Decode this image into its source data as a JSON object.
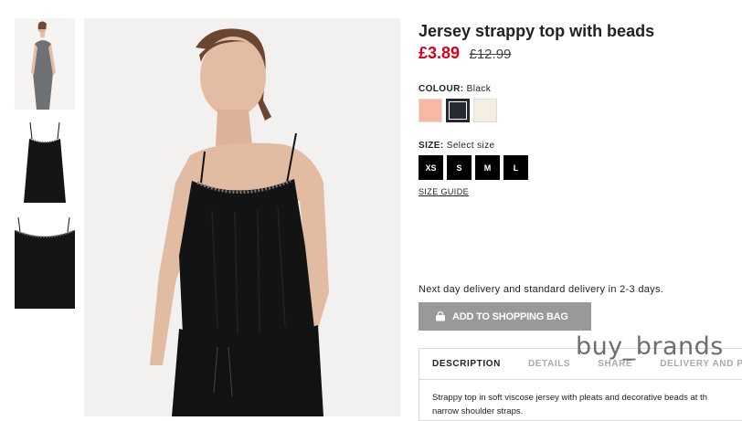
{
  "gallery": {
    "thumbnails": [
      {
        "alt": "model-full-view"
      },
      {
        "alt": "top-front-view"
      },
      {
        "alt": "top-neckline-detail"
      }
    ]
  },
  "product": {
    "title": "Jersey strappy top with beads",
    "price_current": "£3.89",
    "price_original": "£12.99"
  },
  "colour": {
    "label": "COLOUR:",
    "selected": "Black",
    "swatches": [
      {
        "name": "Peach",
        "color": "#f8b9a2"
      },
      {
        "name": "Black",
        "color": "#262a33",
        "selected": true
      },
      {
        "name": "Off-white",
        "color": "#f5efe3"
      }
    ]
  },
  "size": {
    "label": "SIZE:",
    "prompt": "Select size",
    "options": [
      "XS",
      "S",
      "M",
      "L"
    ],
    "guide_link": "SIZE GUIDE"
  },
  "delivery": {
    "text": "Next day delivery and standard delivery in 2-3 days."
  },
  "cart": {
    "add_label": "ADD TO SHOPPING BAG",
    "icon": "shopping-bag-icon"
  },
  "info_tabs": {
    "tabs": [
      "DESCRIPTION",
      "DETAILS",
      "SHARE",
      "DELIVERY AND P"
    ],
    "active": "DESCRIPTION",
    "description_line1": "Strappy top in soft viscose jersey with pleats and decorative beads at th",
    "description_line2": "narrow shoulder straps."
  },
  "watermark": "buy_brands"
}
